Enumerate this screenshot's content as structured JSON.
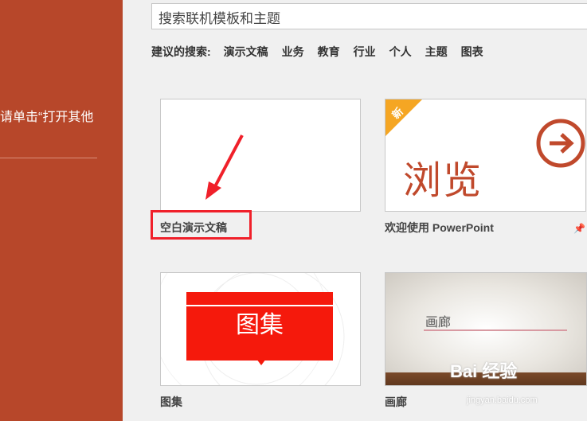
{
  "sidebar": {
    "text": "请单击“打开其他"
  },
  "search": {
    "value": "搜索联机模板和主题"
  },
  "suggestions": {
    "label": "建议的搜索:",
    "links": [
      "演示文稿",
      "业务",
      "教育",
      "行业",
      "个人",
      "主题",
      "图表"
    ]
  },
  "templates": [
    {
      "caption": "空白演示文稿"
    },
    {
      "caption": "欢迎使用 PowerPoint",
      "badge": "新",
      "thumb_text": "浏览"
    },
    {
      "caption": "图集",
      "thumb_text": "图集"
    },
    {
      "caption": "画廊",
      "thumb_text": "画廊"
    }
  ],
  "watermark": {
    "text": "Bai 经验",
    "sub": "jingyan.baidu.com"
  },
  "colors": {
    "sidebar": "#b7472a",
    "highlight": "#f0202a",
    "accent": "#c0492c",
    "badge": "#f5a623",
    "gallery_red": "#f5190c"
  }
}
